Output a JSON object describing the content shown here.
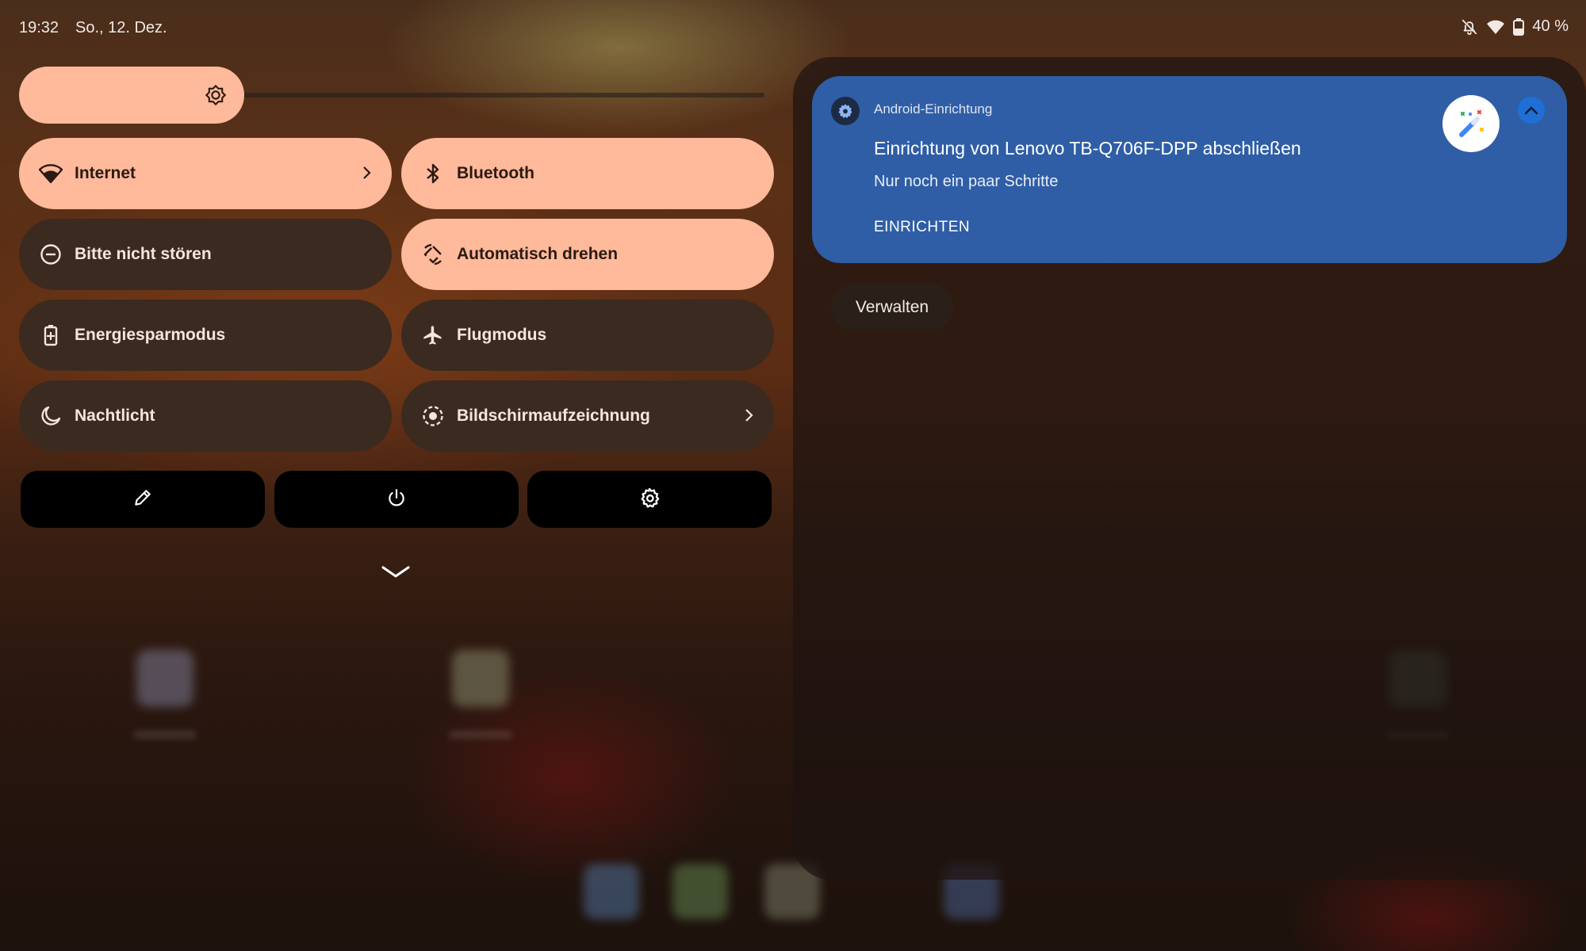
{
  "status_bar": {
    "time": "19:32",
    "date": "So., 12. Dez.",
    "battery": "40 %",
    "icons": [
      "notifications-off-icon",
      "wifi-icon",
      "battery-icon"
    ]
  },
  "brightness": {
    "level": 0.3,
    "icon": "brightness-icon"
  },
  "tiles": [
    {
      "label": "Internet",
      "icon": "wifi-icon",
      "state": "on",
      "has_chevron": true
    },
    {
      "label": "Bluetooth",
      "icon": "bluetooth-icon",
      "state": "on",
      "has_chevron": false
    },
    {
      "label": "Bitte nicht stören",
      "icon": "do-not-disturb-icon",
      "state": "off",
      "has_chevron": false
    },
    {
      "label": "Automatisch drehen",
      "icon": "auto-rotate-icon",
      "state": "on",
      "has_chevron": false
    },
    {
      "label": "Energiesparmodus",
      "icon": "battery-saver-icon",
      "state": "off",
      "has_chevron": false
    },
    {
      "label": "Flugmodus",
      "icon": "airplane-icon",
      "state": "off",
      "has_chevron": false
    },
    {
      "label": "Nachtlicht",
      "icon": "moon-icon",
      "state": "off",
      "has_chevron": false
    },
    {
      "label": "Bildschirmaufzeichnung",
      "icon": "screen-record-icon",
      "state": "off",
      "has_chevron": true
    }
  ],
  "footer_buttons": [
    "edit-icon",
    "power-icon",
    "settings-icon"
  ],
  "notification": {
    "app_name": "Android-Einrichtung",
    "title": "Einrichtung von Lenovo TB-Q706F-DPP abschließen",
    "text": "Nur noch ein paar Schritte",
    "action": "EINRICHTEN",
    "app_icon": "gear-icon",
    "large_icon": "magic-wand-icon"
  },
  "manage_button": "Verwalten",
  "colors": {
    "tile_on": "#ffb99b",
    "tile_off": "#3b2a20",
    "notification_bg": "#2f5ea6",
    "collapse_button": "#1f6fd6"
  }
}
